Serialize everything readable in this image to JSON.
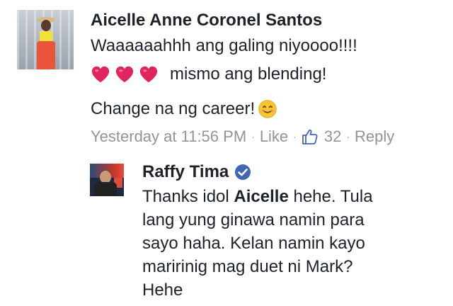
{
  "comment": {
    "author": "Aicelle Anne Coronel Santos",
    "line1": "Waaaaaahhh ang galing niyoooo!!!!",
    "line2_text": "mismo ang blending!",
    "line2_icons": [
      "heart-icon",
      "heart-icon",
      "heart-icon"
    ],
    "line3_text": "Change na ng career!",
    "line3_icon": "smile-emoji-icon",
    "meta": {
      "timestamp": "Yesterday at 11:56 PM",
      "separator": "·",
      "like_label": "Like",
      "like_icon": "thumbs-up-icon",
      "like_count": "32",
      "reply_label": "Reply"
    }
  },
  "reply": {
    "author": "Raffy Tima",
    "verified_icon": "verified-badge-icon",
    "lines": [
      {
        "before": "Thanks idol ",
        "mention": "Aicelle",
        "after": " hehe. Tula"
      },
      {
        "text": "lang yung ginawa namin para"
      },
      {
        "text": "sayo haha. Kelan namin kayo"
      },
      {
        "text": "maririnig mag duet ni Mark?"
      },
      {
        "text": "Hehe"
      }
    ]
  },
  "colors": {
    "text": "#1d2129",
    "meta": "#90949c",
    "heart": "#e0245e",
    "verified": "#4267b2",
    "emoji": "#f7c531"
  }
}
